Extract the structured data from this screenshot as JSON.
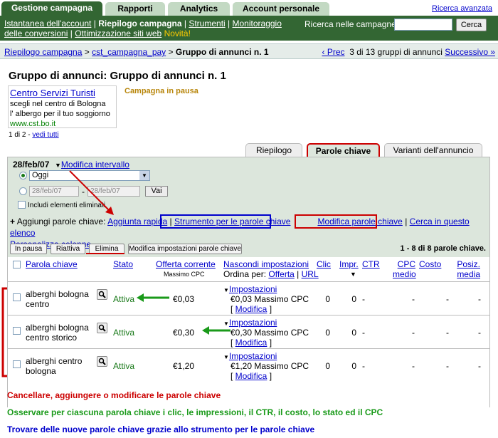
{
  "tabs": [
    "Gestione campagna",
    "Rapporti",
    "Analytics",
    "Account personale"
  ],
  "advanced_search": "Ricerca avanzata",
  "nav": {
    "items": [
      "Istantanea dell'account",
      "Riepilogo campagna",
      "Strumenti",
      "Monitoraggio delle conversioni",
      "Ottimizzazione siti web"
    ],
    "new_badge": "Novità!"
  },
  "search": {
    "label": "Ricerca nelle campagne:",
    "button": "Cerca",
    "value": ""
  },
  "breadcrumb": {
    "items": [
      "Riepilogo campagna",
      "cst_campagna_pay"
    ],
    "current": "Gruppo di annunci n. 1",
    "sep": ">"
  },
  "pager": {
    "prev": "‹ Prec",
    "text": "3 di 13 gruppi di annunci",
    "next": "Successivo »"
  },
  "page_title": "Gruppo di annunci: Gruppo di annunci n. 1",
  "ad": {
    "headline": "Centro Servizi Turisti",
    "line1": "scegli nel centro di Bologna",
    "line2": "l' albergo per il tuo soggiorno",
    "url": "www.cst.bo.it"
  },
  "campaign_status": "Campagna in pausa",
  "ad_count": {
    "text": "1 di 2 - ",
    "link": "vedi tutti"
  },
  "content_tabs": [
    "Riepilogo",
    "Parole chiave",
    "Varianti dell'annuncio"
  ],
  "date": {
    "current": "28/feb/07",
    "modify": "Modifica intervallo",
    "option": "Oggi",
    "from": "28/feb/07",
    "to": "28/feb/07",
    "dash": "-",
    "go": "Vai",
    "include_deleted": "Includi elementi eliminati"
  },
  "keyword_actions": {
    "prefix": "Aggiungi parole chiave:",
    "quick_add": "Aggiunta rapida",
    "tool": "Strumento per le parole chiave",
    "edit": "Modifica parole chiave",
    "search_list": "Cerca in questo elenco",
    "customize": "Personalizza colonne",
    "sep": "|"
  },
  "buttons": [
    "In pausa",
    "Riattiva",
    "Elimina",
    "Modifica impostazioni parole chiave"
  ],
  "range": "1 - 8 di 8 parole chiave.",
  "headers": {
    "keyword": "Parola chiave",
    "status": "Stato",
    "bid": "Offerta corrente",
    "bid_sub": "Massimo CPC",
    "hide_settings": "Nascondi impostazioni",
    "order_by": "Ordina per:",
    "order_bid": "Offerta",
    "order_url": "URL",
    "clicks": "Clic",
    "impr": "Impr.",
    "ctr": "CTR",
    "cpc": "CPC medio",
    "cost": "Costo",
    "pos": "Posiz. media"
  },
  "rows": [
    {
      "keyword": "alberghi bologna centro",
      "status": "Attiva",
      "bid": "€0,03",
      "settings": "Impostazioni",
      "settings_bid": "€0,03 Massimo CPC",
      "modify": "Modifica",
      "clicks": "0",
      "impr": "0",
      "ctr": "-",
      "cpc": "-",
      "cost": "-",
      "pos": "-"
    },
    {
      "keyword": "alberghi bologna centro storico",
      "status": "Attiva",
      "bid": "€0,30",
      "settings": "Impostazioni",
      "settings_bid": "€0,30 Massimo CPC",
      "modify": "Modifica",
      "clicks": "0",
      "impr": "0",
      "ctr": "-",
      "cpc": "-",
      "cost": "-",
      "pos": "-"
    },
    {
      "keyword": "alberghi centro bologna",
      "status": "Attiva",
      "bid": "€1,20",
      "settings": "Impostazioni",
      "settings_bid": "€1,20 Massimo CPC",
      "modify": "Modifica",
      "clicks": "0",
      "impr": "0",
      "ctr": "-",
      "cpc": "-",
      "cost": "-",
      "pos": "-"
    }
  ],
  "notes": [
    {
      "text": "Cancellare, aggiungere o modificare le parole chiave",
      "color": "#cc0000"
    },
    {
      "text": "Osservare per ciascuna parola chiave i clic, le impressioni, il CTR, il costo, lo stato ed il CPC",
      "color": "#1a9a1a"
    },
    {
      "text": "Trovare delle nuove parole chiave grazie allo strumento per le parole chiave",
      "color": "#0000cc"
    }
  ]
}
